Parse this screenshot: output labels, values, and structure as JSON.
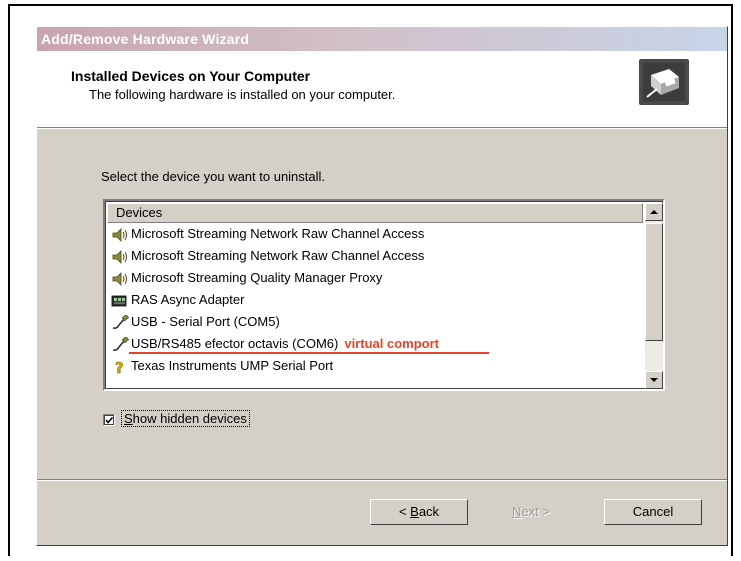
{
  "window": {
    "title": "Add/Remove Hardware Wizard"
  },
  "header": {
    "title": "Installed Devices on Your Computer",
    "subtitle": "The following hardware is installed on your computer.",
    "icon": "hardware-wizard-icon"
  },
  "body": {
    "instruction": "Select the device you want to uninstall."
  },
  "device_list": {
    "column_header": "Devices",
    "items": [
      {
        "icon": "speaker-icon",
        "label": "Microsoft Streaming Network Raw Channel Access"
      },
      {
        "icon": "speaker-icon",
        "label": "Microsoft Streaming Network Raw Channel Access"
      },
      {
        "icon": "speaker-icon",
        "label": "Microsoft Streaming Quality Manager Proxy"
      },
      {
        "icon": "network-adapter-icon",
        "label": "RAS Async Adapter"
      },
      {
        "icon": "usb-plug-icon",
        "label": "USB - Serial Port (COM5)"
      },
      {
        "icon": "usb-plug-icon",
        "label": "USB/RS485 efector octavis (COM6)",
        "annotation": "virtual comport"
      },
      {
        "icon": "unknown-device-icon",
        "label": "Texas Instruments UMP Serial Port"
      }
    ],
    "annotation_color": "#e5462a"
  },
  "options": {
    "show_hidden_label_prefix": "",
    "show_hidden_access_key": "S",
    "show_hidden_label_rest": "how hidden devices",
    "show_hidden_checked": true
  },
  "buttons": {
    "back_prefix": "< ",
    "back_key": "B",
    "back_rest": "ack",
    "next_key": "N",
    "next_rest": "ext >",
    "cancel": "Cancel"
  }
}
